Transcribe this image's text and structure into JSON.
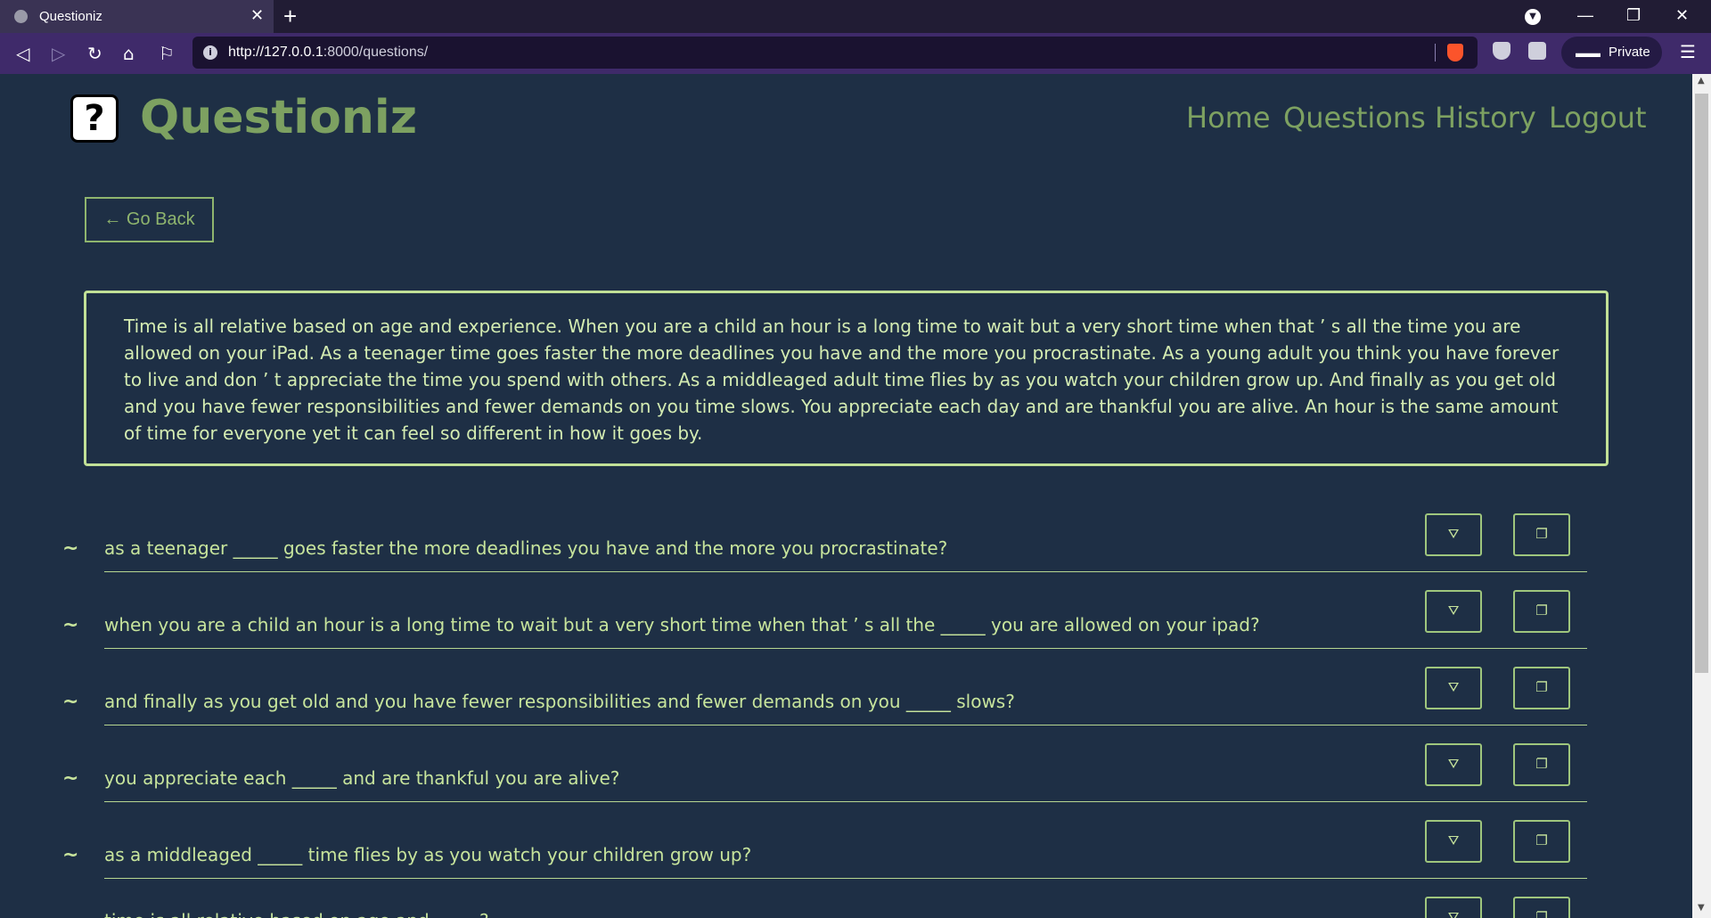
{
  "browser": {
    "tab_title": "Questioniz",
    "tab_close": "✕",
    "new_tab": "+",
    "url_host": "http://127.0.0.1",
    "url_rest": ":8000/questions/",
    "private_label": "Private"
  },
  "header": {
    "logo_glyph": "?",
    "brand": "Questioniz",
    "nav": [
      "Home",
      "Questions",
      "History",
      "Logout"
    ]
  },
  "go_back_label": "← Go Back",
  "passage": "Time is all relative based on age and experience. When you are a child an hour is a long time to wait but a very short time when that ’ s all the time you are allowed on your iPad. As a teenager time goes faster the more deadlines you have and the more you procrastinate. As a young adult you think you have forever to live and don ’ t appreciate the time you spend with others. As a middleaged adult time flies by as you watch your children grow up. And finally as you get old and you have fewer responsibilities and fewer demands on you time slows. You appreciate each day and are thankful you are alive. An hour is the same amount of time for everyone yet it can feel so different in how it goes by.",
  "questions": [
    "as a teenager _____ goes faster the more deadlines you have and the more you procrastinate?",
    "when you are a child an hour is a long time to wait but a very short time when that ’ s all the _____ you are allowed on your ipad?",
    "and finally as you get old and you have fewer responsibilities and fewer demands on you _____ slows?",
    "you appreciate each _____ and are thankful you are alive?",
    "as a middleaged _____ time flies by as you watch your children grow up?",
    "time is all relative based on age and _____?"
  ],
  "row_icons": {
    "tilde": "~",
    "answer_icon": "⛛",
    "copy_icon": "❐"
  }
}
